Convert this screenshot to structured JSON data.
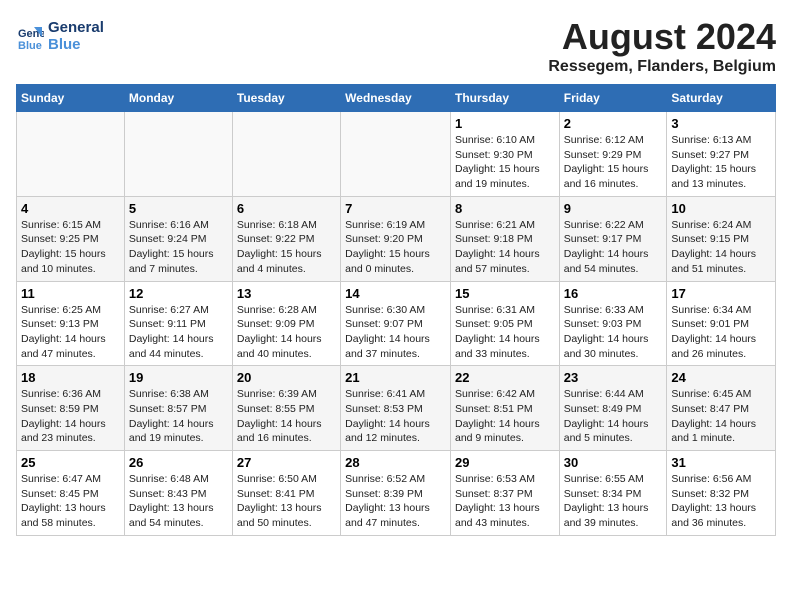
{
  "header": {
    "logo_line1": "General",
    "logo_line2": "Blue",
    "title": "August 2024",
    "subtitle": "Ressegem, Flanders, Belgium"
  },
  "calendar": {
    "days_of_week": [
      "Sunday",
      "Monday",
      "Tuesday",
      "Wednesday",
      "Thursday",
      "Friday",
      "Saturday"
    ],
    "weeks": [
      [
        {
          "day": "",
          "info": ""
        },
        {
          "day": "",
          "info": ""
        },
        {
          "day": "",
          "info": ""
        },
        {
          "day": "",
          "info": ""
        },
        {
          "day": "1",
          "info": "Sunrise: 6:10 AM\nSunset: 9:30 PM\nDaylight: 15 hours\nand 19 minutes."
        },
        {
          "day": "2",
          "info": "Sunrise: 6:12 AM\nSunset: 9:29 PM\nDaylight: 15 hours\nand 16 minutes."
        },
        {
          "day": "3",
          "info": "Sunrise: 6:13 AM\nSunset: 9:27 PM\nDaylight: 15 hours\nand 13 minutes."
        }
      ],
      [
        {
          "day": "4",
          "info": "Sunrise: 6:15 AM\nSunset: 9:25 PM\nDaylight: 15 hours\nand 10 minutes."
        },
        {
          "day": "5",
          "info": "Sunrise: 6:16 AM\nSunset: 9:24 PM\nDaylight: 15 hours\nand 7 minutes."
        },
        {
          "day": "6",
          "info": "Sunrise: 6:18 AM\nSunset: 9:22 PM\nDaylight: 15 hours\nand 4 minutes."
        },
        {
          "day": "7",
          "info": "Sunrise: 6:19 AM\nSunset: 9:20 PM\nDaylight: 15 hours\nand 0 minutes."
        },
        {
          "day": "8",
          "info": "Sunrise: 6:21 AM\nSunset: 9:18 PM\nDaylight: 14 hours\nand 57 minutes."
        },
        {
          "day": "9",
          "info": "Sunrise: 6:22 AM\nSunset: 9:17 PM\nDaylight: 14 hours\nand 54 minutes."
        },
        {
          "day": "10",
          "info": "Sunrise: 6:24 AM\nSunset: 9:15 PM\nDaylight: 14 hours\nand 51 minutes."
        }
      ],
      [
        {
          "day": "11",
          "info": "Sunrise: 6:25 AM\nSunset: 9:13 PM\nDaylight: 14 hours\nand 47 minutes."
        },
        {
          "day": "12",
          "info": "Sunrise: 6:27 AM\nSunset: 9:11 PM\nDaylight: 14 hours\nand 44 minutes."
        },
        {
          "day": "13",
          "info": "Sunrise: 6:28 AM\nSunset: 9:09 PM\nDaylight: 14 hours\nand 40 minutes."
        },
        {
          "day": "14",
          "info": "Sunrise: 6:30 AM\nSunset: 9:07 PM\nDaylight: 14 hours\nand 37 minutes."
        },
        {
          "day": "15",
          "info": "Sunrise: 6:31 AM\nSunset: 9:05 PM\nDaylight: 14 hours\nand 33 minutes."
        },
        {
          "day": "16",
          "info": "Sunrise: 6:33 AM\nSunset: 9:03 PM\nDaylight: 14 hours\nand 30 minutes."
        },
        {
          "day": "17",
          "info": "Sunrise: 6:34 AM\nSunset: 9:01 PM\nDaylight: 14 hours\nand 26 minutes."
        }
      ],
      [
        {
          "day": "18",
          "info": "Sunrise: 6:36 AM\nSunset: 8:59 PM\nDaylight: 14 hours\nand 23 minutes."
        },
        {
          "day": "19",
          "info": "Sunrise: 6:38 AM\nSunset: 8:57 PM\nDaylight: 14 hours\nand 19 minutes."
        },
        {
          "day": "20",
          "info": "Sunrise: 6:39 AM\nSunset: 8:55 PM\nDaylight: 14 hours\nand 16 minutes."
        },
        {
          "day": "21",
          "info": "Sunrise: 6:41 AM\nSunset: 8:53 PM\nDaylight: 14 hours\nand 12 minutes."
        },
        {
          "day": "22",
          "info": "Sunrise: 6:42 AM\nSunset: 8:51 PM\nDaylight: 14 hours\nand 9 minutes."
        },
        {
          "day": "23",
          "info": "Sunrise: 6:44 AM\nSunset: 8:49 PM\nDaylight: 14 hours\nand 5 minutes."
        },
        {
          "day": "24",
          "info": "Sunrise: 6:45 AM\nSunset: 8:47 PM\nDaylight: 14 hours\nand 1 minute."
        }
      ],
      [
        {
          "day": "25",
          "info": "Sunrise: 6:47 AM\nSunset: 8:45 PM\nDaylight: 13 hours\nand 58 minutes."
        },
        {
          "day": "26",
          "info": "Sunrise: 6:48 AM\nSunset: 8:43 PM\nDaylight: 13 hours\nand 54 minutes."
        },
        {
          "day": "27",
          "info": "Sunrise: 6:50 AM\nSunset: 8:41 PM\nDaylight: 13 hours\nand 50 minutes."
        },
        {
          "day": "28",
          "info": "Sunrise: 6:52 AM\nSunset: 8:39 PM\nDaylight: 13 hours\nand 47 minutes."
        },
        {
          "day": "29",
          "info": "Sunrise: 6:53 AM\nSunset: 8:37 PM\nDaylight: 13 hours\nand 43 minutes."
        },
        {
          "day": "30",
          "info": "Sunrise: 6:55 AM\nSunset: 8:34 PM\nDaylight: 13 hours\nand 39 minutes."
        },
        {
          "day": "31",
          "info": "Sunrise: 6:56 AM\nSunset: 8:32 PM\nDaylight: 13 hours\nand 36 minutes."
        }
      ]
    ]
  }
}
